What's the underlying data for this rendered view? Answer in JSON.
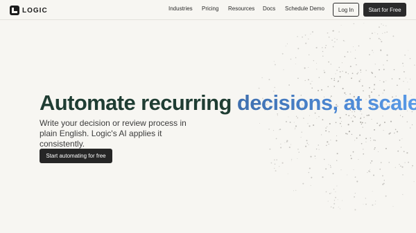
{
  "header": {
    "logo_text": "LOGIC",
    "nav": [
      "Industries",
      "Pricing",
      "Resources",
      "Docs",
      "Schedule Demo"
    ],
    "login_label": "Log In",
    "cta_label": "Start for Free"
  },
  "hero": {
    "title_part1": "Automate recurring",
    "title_part2": "decisions, at scale",
    "subtitle": "Write your decision or review process in plain English. Logic's AI applies it consistently.",
    "cta_label": "Start automating for free"
  },
  "colors": {
    "background": "#f7f6f2",
    "title_dark": "#1f3d33",
    "title_accent_start": "#3f6fae",
    "title_accent_end": "#5a9be8",
    "button_dark": "#262626"
  }
}
